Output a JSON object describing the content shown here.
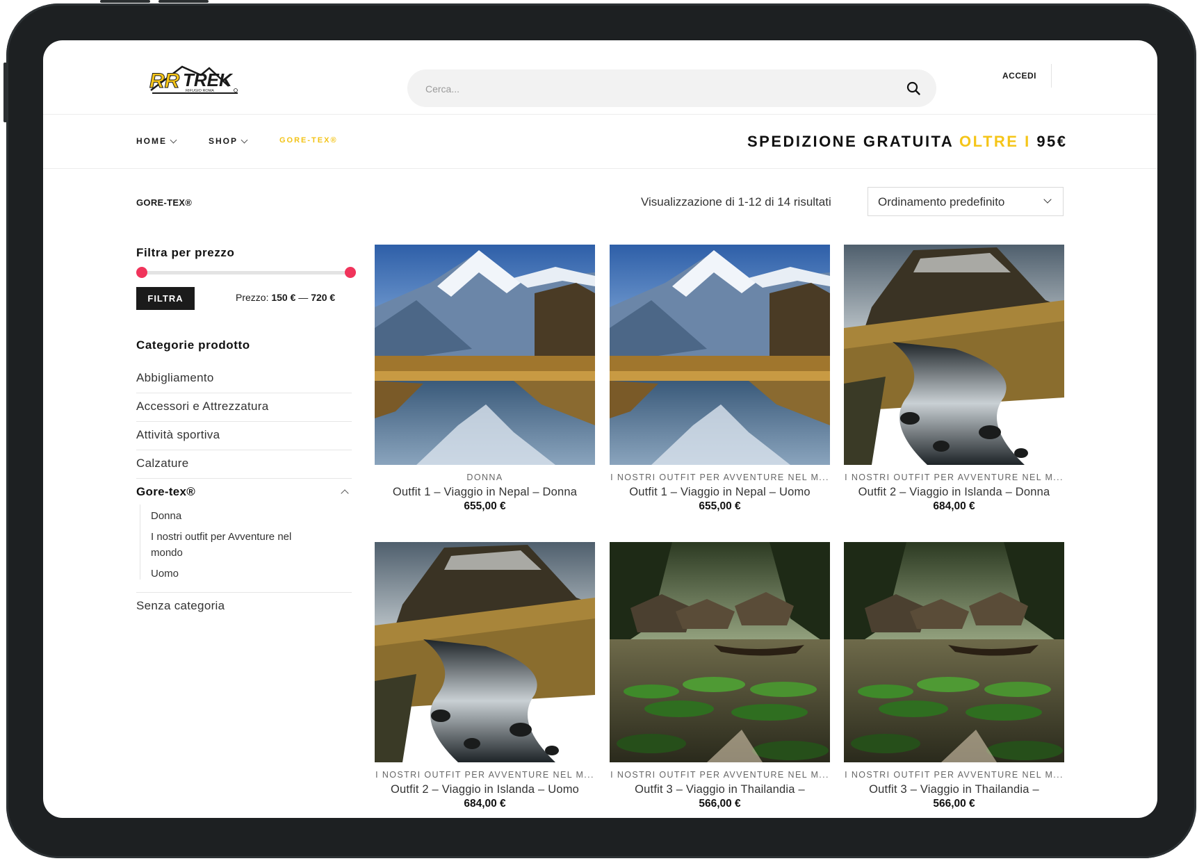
{
  "header": {
    "logo_text": "RRTREK",
    "logo_subtext": "RIFUGIO ROMA",
    "search_placeholder": "Cerca...",
    "login_label": "ACCEDI"
  },
  "nav": {
    "items": [
      {
        "label": "HOME"
      },
      {
        "label": "SHOP"
      },
      {
        "label": "GORE-TEX®"
      }
    ],
    "promo": {
      "part1": "SPEDIZIONE GRATUITA ",
      "part2": "OLTRE I ",
      "part3": "95€"
    }
  },
  "breadcrumb": "GORE-TEX®",
  "toolbar": {
    "result_count": "Visualizzazione di 1-12 di 14 risultati",
    "sort_selected": "Ordinamento predefinito"
  },
  "sidebar": {
    "price_filter_title": "Filtra per prezzo",
    "filter_button": "FILTRA",
    "price_prefix": "Prezzo:",
    "price_min": "150 €",
    "price_sep": "—",
    "price_max": "720 €",
    "categories_title": "Categorie prodotto",
    "categories": [
      "Abbigliamento",
      "Accessori e Attrezzatura",
      "Attività sportiva",
      "Calzature",
      "Gore-tex®",
      "Senza categoria"
    ],
    "subcategories": [
      "Donna",
      "I nostri outfit per Avventure nel mondo",
      "Uomo"
    ]
  },
  "products": [
    {
      "category": "DONNA",
      "title": "Outfit 1 – Viaggio in Nepal – Donna",
      "price": "655,00 €",
      "image": "nepal-mountain-lake"
    },
    {
      "category": "I NOSTRI OUTFIT PER AVVENTURE NEL M...",
      "title": "Outfit 1 – Viaggio in Nepal – Uomo",
      "price": "655,00 €",
      "image": "nepal-mountain-lake"
    },
    {
      "category": "I NOSTRI OUTFIT PER AVVENTURE NEL M...",
      "title": "Outfit 2 – Viaggio in Islanda – Donna",
      "price": "684,00 €",
      "image": "iceland-mountain-stream"
    },
    {
      "category": "I NOSTRI OUTFIT PER AVVENTURE NEL M...",
      "title": "Outfit 2 – Viaggio in Islanda – Uomo",
      "price": "684,00 €",
      "image": "iceland-mountain-stream"
    },
    {
      "category": "I NOSTRI OUTFIT PER AVVENTURE NEL M...",
      "title": "Outfit 3 – Viaggio in Thailandia –",
      "price": "566,00 €",
      "image": "thailand-jungle-pond"
    },
    {
      "category": "I NOSTRI OUTFIT PER AVVENTURE NEL M...",
      "title": "Outfit 3 – Viaggio in Thailandia –",
      "price": "566,00 €",
      "image": "thailand-jungle-pond"
    }
  ],
  "colors": {
    "accent_yellow": "#f5c518",
    "slider_handle": "#f0345b",
    "frame": "#1d2022"
  }
}
